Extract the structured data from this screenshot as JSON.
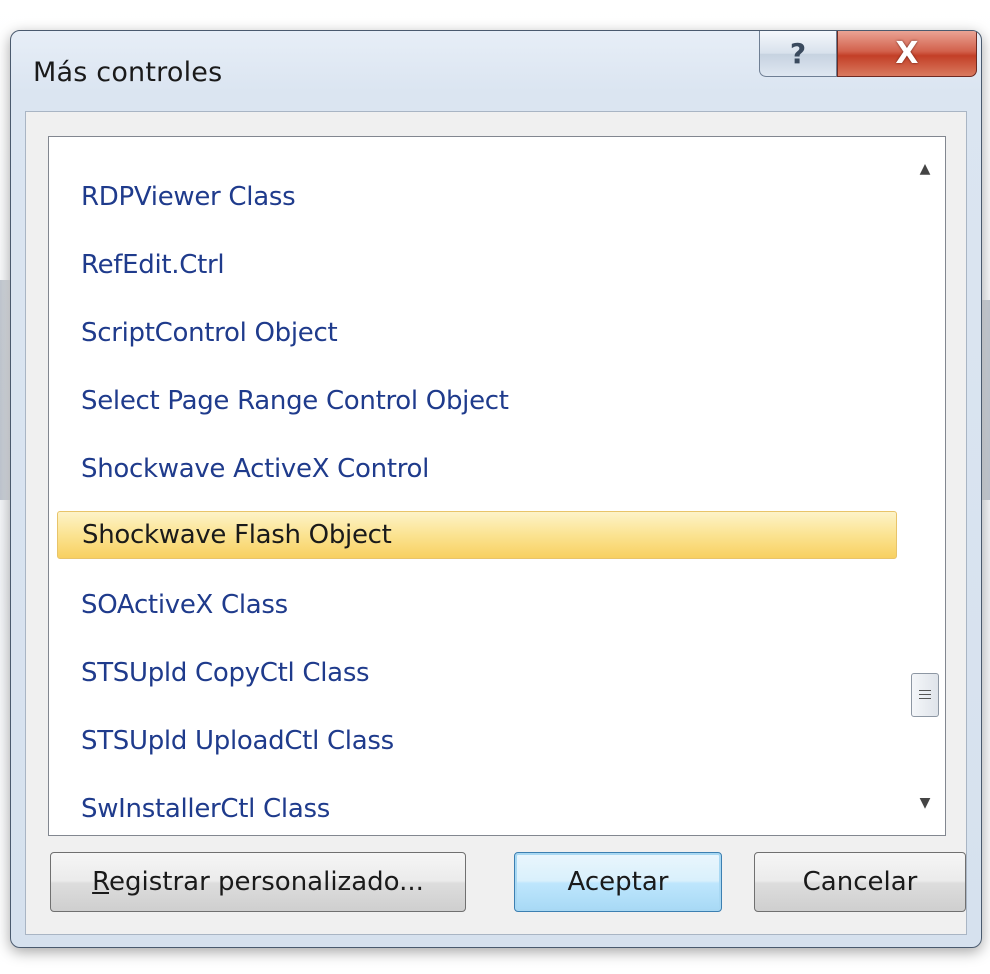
{
  "dialog": {
    "title": "Más controles",
    "help_label": "?",
    "close_label": "X"
  },
  "list": {
    "items": [
      "RDPViewer Class",
      "RefEdit.Ctrl",
      "ScriptControl Object",
      "Select Page Range Control Object",
      "Shockwave ActiveX Control",
      "Shockwave Flash Object",
      "SOActiveX Class",
      "STSUpld CopyCtl Class",
      "STSUpld UploadCtl Class",
      "SwInstallerCtl Class"
    ],
    "selected_item": "Shockwave Flash Object",
    "scroll_up_icon": "arrow-up-icon",
    "scroll_down_icon": "arrow-down-icon"
  },
  "buttons": {
    "register_mnemonic": "R",
    "register_rest": "egistrar personalizado...",
    "accept": "Aceptar",
    "cancel": "Cancelar"
  },
  "colors": {
    "item_text": "#1f3b8c",
    "selection": "#fbe391",
    "close_red": "#c33f27"
  }
}
